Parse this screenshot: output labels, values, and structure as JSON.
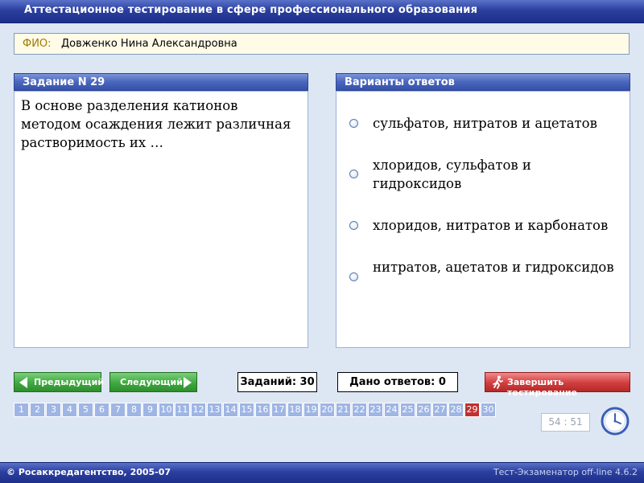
{
  "window": {
    "title": "Аттестационное тестирование в сфере профессионального образования"
  },
  "student": {
    "label": "ФИО:",
    "name": "Довженко Нина Александровна"
  },
  "question_panel": {
    "header": "Задание N 29",
    "text": "В основе разделения катионов методом осаждения лежит различная растворимость их …"
  },
  "answers_panel": {
    "header": "Варианты ответов",
    "options": [
      "сульфатов, нитратов и ацетатов",
      "хлоридов, сульфатов и гидроксидов",
      "хлоридов, нитратов и карбонатов",
      "нитратов, ацетатов и гидроксидов"
    ]
  },
  "nav": {
    "prev_label": "Предыдущий",
    "next_label": "Следующий",
    "tasks_count": "Заданий: 30",
    "answered_count": "Дано ответов: 0",
    "finish_label": "Завершить тестирование"
  },
  "pages": {
    "items": [
      "1",
      "2",
      "3",
      "4",
      "5",
      "6",
      "7",
      "8",
      "9",
      "10",
      "11",
      "12",
      "13",
      "14",
      "15",
      "16",
      "17",
      "18",
      "19",
      "20",
      "21",
      "22",
      "23",
      "24",
      "25",
      "26",
      "27",
      "28",
      "29",
      "30"
    ],
    "current": "29"
  },
  "timer": {
    "value": "54 : 51"
  },
  "footer": {
    "copyright": "© Росаккредагентство, 2005-07",
    "version": "Тест-Экзаменатор off-line 4.6.2"
  },
  "colors": {
    "title_bar": "#2b3f9f",
    "panel_header": "#4a66bd",
    "button_green": "#3fa83f",
    "button_red": "#d13d3d",
    "page_current": "#c03030",
    "page_default": "#9fb6e4"
  }
}
